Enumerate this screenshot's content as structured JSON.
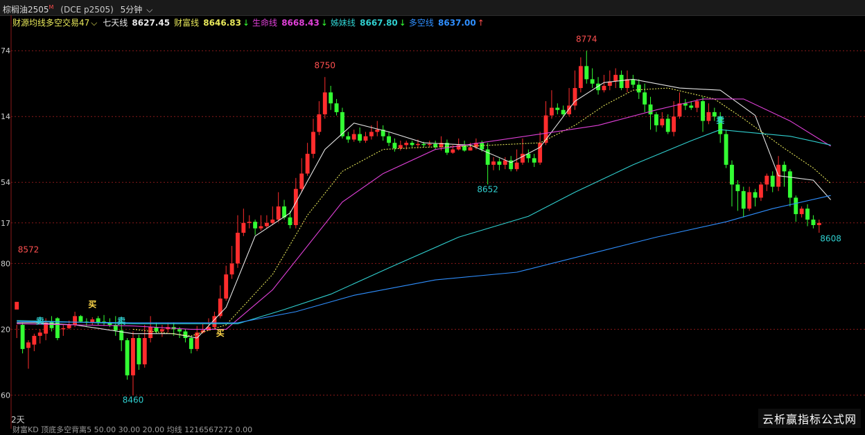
{
  "header": {
    "symbol": "棕榈油2505",
    "marker": "M",
    "code": "(DCE p2505)",
    "period": "5分钟",
    "period_caret": "⌵"
  },
  "legend": {
    "indicator": "财源均线多空交易47",
    "indicator_caret": "⌵",
    "items": [
      {
        "label": "七天线",
        "value": "8627.45",
        "arrow": "",
        "color": "#e6e6e6"
      },
      {
        "label": "财富线",
        "value": "8646.83",
        "arrow": "↓",
        "color": "#e8e85a"
      },
      {
        "label": "生命线",
        "value": "8668.43",
        "arrow": "↓",
        "color": "#e040d8"
      },
      {
        "label": "姊妹线",
        "value": "8667.80",
        "arrow": "↓",
        "color": "#30d0d0"
      },
      {
        "label": "多空线",
        "value": "8637.00",
        "arrow": "↑",
        "color": "#2f8fff"
      }
    ]
  },
  "chart_data": {
    "type": "candlestick",
    "ylim": [
      8440,
      8795
    ],
    "y_ticks": [
      {
        "label": "74",
        "value": 8774
      },
      {
        "label": "14",
        "value": 8714
      },
      {
        "label": "54",
        "value": 8654
      },
      {
        "label": "17",
        "value": 8617
      },
      {
        "label": "80",
        "value": 8580
      },
      {
        "label": "20",
        "value": 8520
      },
      {
        "label": "60",
        "value": 8460
      }
    ],
    "colors": {
      "up": "#ff2d2d",
      "down": "#33ff33",
      "grid": "#8b1a1a"
    },
    "candles": [
      [
        8538,
        8545,
        8524,
        8512
      ],
      [
        8524,
        8502,
        8526,
        8498
      ],
      [
        8503,
        8508,
        8510,
        8484
      ],
      [
        8506,
        8514,
        8516,
        8500
      ],
      [
        8514,
        8517,
        8520,
        8507
      ],
      [
        8516,
        8526,
        8530,
        8510
      ],
      [
        8527,
        8521,
        8532,
        8518
      ],
      [
        8530,
        8512,
        8531,
        8510
      ],
      [
        8520,
        8521,
        8524,
        8514
      ],
      [
        8521,
        8524,
        8528,
        8520
      ],
      [
        8524,
        8532,
        8536,
        8522
      ],
      [
        8532,
        8527,
        8533,
        8526
      ],
      [
        8527,
        8526,
        8530,
        8523
      ],
      [
        8526,
        8529,
        8531,
        8524
      ],
      [
        8530,
        8526,
        8532,
        8524
      ],
      [
        8527,
        8526,
        8533,
        8523
      ],
      [
        8526,
        8524,
        8530,
        8522
      ],
      [
        8524,
        8519,
        8532,
        8514
      ],
      [
        8519,
        8510,
        8528,
        8500
      ],
      [
        8510,
        8478,
        8512,
        8474
      ],
      [
        8478,
        8512,
        8518,
        8460
      ],
      [
        8512,
        8488,
        8515,
        8483
      ],
      [
        8488,
        8512,
        8524,
        8485
      ],
      [
        8512,
        8522,
        8532,
        8508
      ],
      [
        8522,
        8518,
        8526,
        8516
      ],
      [
        8518,
        8520,
        8524,
        8513
      ],
      [
        8520,
        8522,
        8526,
        8517
      ],
      [
        8522,
        8520,
        8526,
        8514
      ],
      [
        8520,
        8518,
        8522,
        8512
      ],
      [
        8518,
        8512,
        8520,
        8508
      ],
      [
        8512,
        8502,
        8514,
        8498
      ],
      [
        8502,
        8517,
        8523,
        8500
      ],
      [
        8517,
        8519,
        8525,
        8516
      ],
      [
        8519,
        8522,
        8530,
        8519
      ],
      [
        8522,
        8532,
        8536,
        8520
      ],
      [
        8532,
        8548,
        8560,
        8530
      ],
      [
        8548,
        8570,
        8578,
        8546
      ],
      [
        8570,
        8580,
        8596,
        8566
      ],
      [
        8580,
        8608,
        8624,
        8576
      ],
      [
        8608,
        8617,
        8630,
        8605
      ],
      [
        8617,
        8618,
        8624,
        8612
      ],
      [
        8618,
        8612,
        8620,
        8606
      ],
      [
        8612,
        8614,
        8624,
        8610
      ],
      [
        8614,
        8617,
        8624,
        8612
      ],
      [
        8617,
        8620,
        8632,
        8615
      ],
      [
        8620,
        8632,
        8645,
        8618
      ],
      [
        8632,
        8622,
        8638,
        8620
      ],
      [
        8622,
        8615,
        8628,
        8612
      ],
      [
        8615,
        8648,
        8658,
        8612
      ],
      [
        8648,
        8662,
        8676,
        8645
      ],
      [
        8662,
        8680,
        8690,
        8660
      ],
      [
        8680,
        8700,
        8712,
        8676
      ],
      [
        8700,
        8716,
        8728,
        8697
      ],
      [
        8716,
        8736,
        8750,
        8712
      ],
      [
        8736,
        8726,
        8742,
        8720
      ],
      [
        8726,
        8718,
        8730,
        8715
      ],
      [
        8718,
        8696,
        8722,
        8694
      ],
      [
        8696,
        8693,
        8700,
        8690
      ],
      [
        8693,
        8698,
        8702,
        8691
      ],
      [
        8698,
        8692,
        8704,
        8690
      ],
      [
        8692,
        8696,
        8700,
        8690
      ],
      [
        8696,
        8700,
        8706,
        8693
      ],
      [
        8700,
        8702,
        8710,
        8696
      ],
      [
        8702,
        8696,
        8706,
        8692
      ],
      [
        8696,
        8690,
        8700,
        8687
      ],
      [
        8690,
        8685,
        8694,
        8682
      ],
      [
        8685,
        8688,
        8692,
        8683
      ],
      [
        8688,
        8690,
        8692,
        8684
      ],
      [
        8690,
        8688,
        8692,
        8686
      ],
      [
        8688,
        8689,
        8693,
        8685
      ],
      [
        8689,
        8688,
        8691,
        8686
      ],
      [
        8688,
        8689,
        8692,
        8686
      ],
      [
        8689,
        8686,
        8692,
        8684
      ],
      [
        8686,
        8690,
        8696,
        8683
      ],
      [
        8690,
        8681,
        8693,
        8679
      ],
      [
        8681,
        8684,
        8688,
        8680
      ],
      [
        8684,
        8688,
        8694,
        8683
      ],
      [
        8688,
        8683,
        8692,
        8682
      ],
      [
        8683,
        8686,
        8690,
        8683
      ],
      [
        8686,
        8690,
        8694,
        8684
      ],
      [
        8690,
        8684,
        8692,
        8682
      ],
      [
        8684,
        8670,
        8690,
        8652
      ],
      [
        8670,
        8673,
        8677,
        8665
      ],
      [
        8673,
        8670,
        8676,
        8665
      ],
      [
        8670,
        8674,
        8677,
        8666
      ],
      [
        8674,
        8666,
        8678,
        8664
      ],
      [
        8666,
        8672,
        8684,
        8664
      ],
      [
        8672,
        8680,
        8694,
        8670
      ],
      [
        8680,
        8676,
        8684,
        8672
      ],
      [
        8676,
        8672,
        8680,
        8668
      ],
      [
        8672,
        8690,
        8700,
        8670
      ],
      [
        8690,
        8715,
        8728,
        8688
      ],
      [
        8715,
        8722,
        8738,
        8712
      ],
      [
        8722,
        8720,
        8726,
        8716
      ],
      [
        8720,
        8716,
        8724,
        8714
      ],
      [
        8716,
        8724,
        8740,
        8714
      ],
      [
        8724,
        8740,
        8756,
        8720
      ],
      [
        8740,
        8760,
        8768,
        8736
      ],
      [
        8760,
        8748,
        8774,
        8744
      ],
      [
        8748,
        8744,
        8758,
        8740
      ],
      [
        8744,
        8738,
        8750,
        8734
      ],
      [
        8738,
        8742,
        8752,
        8736
      ],
      [
        8742,
        8746,
        8756,
        8738
      ],
      [
        8746,
        8752,
        8758,
        8740
      ],
      [
        8752,
        8740,
        8756,
        8738
      ],
      [
        8740,
        8748,
        8756,
        8736
      ],
      [
        8748,
        8743,
        8752,
        8740
      ],
      [
        8743,
        8736,
        8748,
        8730
      ],
      [
        8736,
        8725,
        8744,
        8718
      ],
      [
        8725,
        8716,
        8732,
        8702
      ],
      [
        8716,
        8706,
        8718,
        8700
      ],
      [
        8706,
        8712,
        8718,
        8704
      ],
      [
        8712,
        8700,
        8716,
        8698
      ],
      [
        8700,
        8714,
        8728,
        8696
      ],
      [
        8714,
        8726,
        8736,
        8712
      ],
      [
        8726,
        8724,
        8730,
        8720
      ],
      [
        8724,
        8722,
        8728,
        8720
      ],
      [
        8722,
        8728,
        8730,
        8718
      ],
      [
        8728,
        8710,
        8732,
        8700
      ],
      [
        8710,
        8718,
        8726,
        8707
      ],
      [
        8718,
        8714,
        8722,
        8710
      ],
      [
        8714,
        8698,
        8718,
        8690
      ],
      [
        8698,
        8670,
        8702,
        8667
      ],
      [
        8670,
        8652,
        8674,
        8632
      ],
      [
        8652,
        8646,
        8656,
        8628
      ],
      [
        8646,
        8630,
        8650,
        8622
      ],
      [
        8630,
        8645,
        8650,
        8628
      ],
      [
        8645,
        8640,
        8648,
        8632
      ],
      [
        8640,
        8652,
        8654,
        8637
      ],
      [
        8652,
        8660,
        8662,
        8646
      ],
      [
        8660,
        8650,
        8664,
        8645
      ],
      [
        8650,
        8670,
        8678,
        8646
      ],
      [
        8670,
        8664,
        8673,
        8650
      ],
      [
        8664,
        8640,
        8666,
        8632
      ],
      [
        8640,
        8625,
        8642,
        8618
      ],
      [
        8625,
        8630,
        8632,
        8622
      ],
      [
        8630,
        8620,
        8634,
        8614
      ],
      [
        8620,
        8615,
        8624,
        8612
      ],
      [
        8615,
        8617,
        8620,
        8608
      ]
    ],
    "ma": [
      {
        "name": "七天线",
        "color": "#e6e6e6",
        "dash": "",
        "points": [
          [
            0,
            8526
          ],
          [
            3,
            8526
          ],
          [
            10,
            8524
          ],
          [
            20,
            8516
          ],
          [
            27,
            8516
          ],
          [
            31,
            8512
          ],
          [
            36,
            8540
          ],
          [
            41,
            8605
          ],
          [
            47,
            8626
          ],
          [
            53,
            8684
          ],
          [
            58,
            8708
          ],
          [
            64,
            8700
          ],
          [
            70,
            8690
          ],
          [
            78,
            8688
          ],
          [
            85,
            8672
          ],
          [
            90,
            8686
          ],
          [
            96,
            8728
          ],
          [
            101,
            8745
          ],
          [
            106,
            8748
          ],
          [
            114,
            8740
          ],
          [
            121,
            8738
          ],
          [
            127,
            8715
          ],
          [
            131,
            8660
          ],
          [
            137,
            8656
          ],
          [
            140,
            8638
          ]
        ]
      },
      {
        "name": "财富线",
        "color": "#e8e85a",
        "dash": "2,2",
        "points": [
          [
            20,
            8520
          ],
          [
            30,
            8514
          ],
          [
            36,
            8524
          ],
          [
            44,
            8570
          ],
          [
            50,
            8624
          ],
          [
            56,
            8664
          ],
          [
            63,
            8684
          ],
          [
            70,
            8686
          ],
          [
            78,
            8687
          ],
          [
            90,
            8690
          ],
          [
            96,
            8706
          ],
          [
            101,
            8724
          ],
          [
            106,
            8738
          ],
          [
            112,
            8740
          ],
          [
            120,
            8730
          ],
          [
            125,
            8712
          ],
          [
            132,
            8685
          ],
          [
            137,
            8667
          ],
          [
            140,
            8653
          ]
        ]
      },
      {
        "name": "生命线",
        "color": "#e040d8",
        "dash": "",
        "points": [
          [
            0,
            8525
          ],
          [
            20,
            8523
          ],
          [
            30,
            8520
          ],
          [
            36,
            8520
          ],
          [
            44,
            8556
          ],
          [
            56,
            8636
          ],
          [
            63,
            8662
          ],
          [
            72,
            8684
          ],
          [
            90,
            8698
          ],
          [
            100,
            8706
          ],
          [
            110,
            8720
          ],
          [
            118,
            8730
          ],
          [
            125,
            8730
          ],
          [
            133,
            8710
          ],
          [
            140,
            8687
          ]
        ]
      },
      {
        "name": "姊妹线",
        "color": "#30d0d0",
        "dash": "",
        "points": [
          [
            0,
            8528
          ],
          [
            20,
            8525
          ],
          [
            38,
            8525
          ],
          [
            46,
            8538
          ],
          [
            54,
            8552
          ],
          [
            64,
            8576
          ],
          [
            76,
            8604
          ],
          [
            88,
            8623
          ],
          [
            96,
            8645
          ],
          [
            106,
            8670
          ],
          [
            116,
            8692
          ],
          [
            121,
            8702
          ],
          [
            125,
            8700
          ],
          [
            133,
            8696
          ],
          [
            140,
            8688
          ]
        ]
      },
      {
        "name": "多空线",
        "color": "#2f8fff",
        "dash": "",
        "points": [
          [
            0,
            8527
          ],
          [
            20,
            8526
          ],
          [
            38,
            8526
          ],
          [
            48,
            8536
          ],
          [
            58,
            8551
          ],
          [
            72,
            8565
          ],
          [
            86,
            8572
          ],
          [
            98,
            8588
          ],
          [
            110,
            8604
          ],
          [
            122,
            8618
          ],
          [
            130,
            8630
          ],
          [
            140,
            8642
          ]
        ]
      }
    ],
    "value_labels": [
      {
        "text": "8572",
        "i": 2,
        "value": 8590,
        "color": "#ff5050"
      },
      {
        "text": "8460",
        "i": 20,
        "value": 8453,
        "color": "#30d0d0"
      },
      {
        "text": "8750",
        "i": 53,
        "value": 8758,
        "color": "#ff5050"
      },
      {
        "text": "8652",
        "i": 81,
        "value": 8645,
        "color": "#30d0d0"
      },
      {
        "text": "8774",
        "i": 98,
        "value": 8782,
        "color": "#ff5050"
      },
      {
        "text": "8608",
        "i": 140,
        "value": 8600,
        "color": "#30d0d0"
      }
    ],
    "signals": [
      {
        "text": "卖",
        "i": 4,
        "value": 8525,
        "color": "#30d0d0"
      },
      {
        "text": "买",
        "i": 13,
        "value": 8540,
        "color": "#ffd84a"
      },
      {
        "text": "卖",
        "i": 18,
        "value": 8525,
        "color": "#30d0d0"
      },
      {
        "text": "买",
        "i": 35,
        "value": 8514,
        "color": "#ffd84a"
      },
      {
        "text": "卖",
        "i": 121,
        "value": 8708,
        "color": "#30d0d0"
      }
    ]
  },
  "footer": {
    "days": "2天",
    "text": "财富KD 顶底多空背离5    50.00   30.00    20.00     均线 1216567272 0.00"
  },
  "watermark": "云析赢指标公式网"
}
